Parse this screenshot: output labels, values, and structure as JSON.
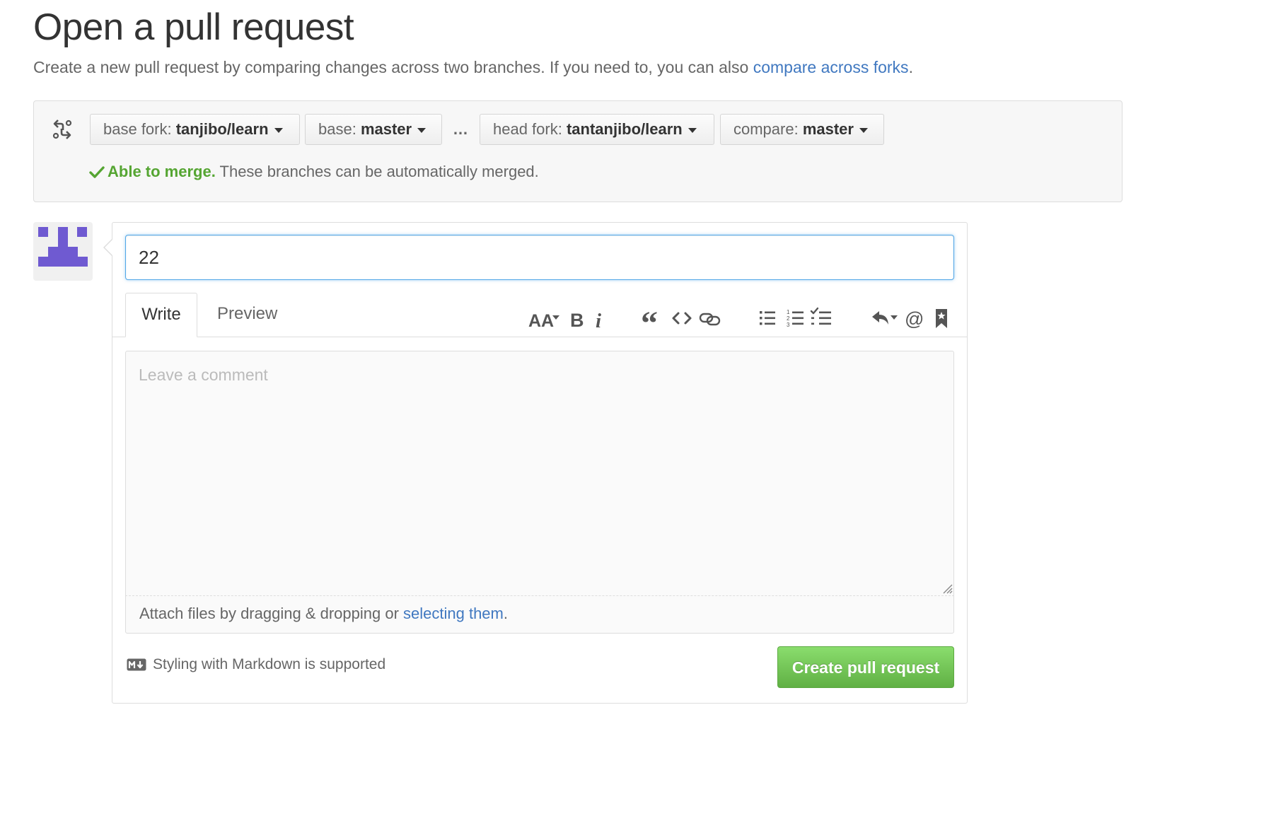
{
  "page": {
    "title": "Open a pull request",
    "subtitle_text": "Create a new pull request by comparing changes across two branches. If you need to, you can also ",
    "subtitle_link": "compare across forks",
    "subtitle_end": "."
  },
  "range": {
    "base_fork": {
      "label": "base fork: ",
      "value": "tanjibo/learn"
    },
    "base": {
      "label": "base: ",
      "value": "master"
    },
    "separator": "…",
    "head_fork": {
      "label": "head fork: ",
      "value": "tantanjibo/learn"
    },
    "compare": {
      "label": "compare: ",
      "value": "master"
    },
    "merge_status_title": "Able to merge.",
    "merge_status_text": " These branches can be automatically merged."
  },
  "form": {
    "title_value": "22",
    "tabs": [
      {
        "label": "Write"
      },
      {
        "label": "Preview"
      }
    ],
    "comment_placeholder": "Leave a comment",
    "attach_text": "Attach files by dragging & dropping or ",
    "attach_link": "selecting them",
    "attach_end": ".",
    "markdown_hint": "Styling with Markdown is supported",
    "submit_label": "Create pull request"
  },
  "toolbar": {
    "icons": [
      "text-size-icon",
      "bold-icon",
      "italic-icon",
      "quote-icon",
      "code-icon",
      "link-icon",
      "bulleted-list-icon",
      "numbered-list-icon",
      "task-list-icon",
      "reply-icon",
      "mention-icon",
      "bookmark-icon"
    ],
    "text_size_glyph": "AA",
    "bold_glyph": "B",
    "italic_glyph": "i",
    "quote_glyph": "“",
    "code_glyph": "<>",
    "mention_glyph": "@"
  },
  "colors": {
    "link": "#4078c0",
    "success": "#55a532",
    "avatar": "#6f5ad1",
    "button_top": "#8add6d",
    "button_bottom": "#60b044",
    "focus_border": "#51a7e8"
  }
}
